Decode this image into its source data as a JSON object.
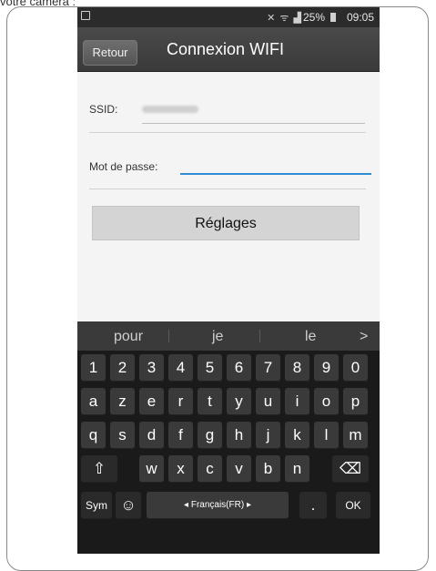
{
  "caption": "votre caméra :",
  "status": {
    "battery": "25%",
    "time": "09:05"
  },
  "nav": {
    "back_label": "Retour",
    "title": "Connexion WIFI"
  },
  "form": {
    "ssid_label": "SSID:",
    "password_label": "Mot de passe:",
    "password_value": "",
    "submit_label": "Réglages"
  },
  "keyboard": {
    "suggestions": [
      "pour",
      "je",
      "le"
    ],
    "suggestion_more": ">",
    "row1": [
      "1",
      "2",
      "3",
      "4",
      "5",
      "6",
      "7",
      "8",
      "9",
      "0"
    ],
    "row2": [
      "a",
      "z",
      "e",
      "r",
      "t",
      "y",
      "u",
      "i",
      "o",
      "p"
    ],
    "row3": [
      "q",
      "s",
      "d",
      "f",
      "g",
      "h",
      "j",
      "k",
      "l",
      "m"
    ],
    "row4": [
      "w",
      "x",
      "c",
      "v",
      "b",
      "n"
    ],
    "shift_label": "⇧",
    "backspace_label": "⌫",
    "sym_label": "Sym",
    "emoji_label": "☺",
    "space_label": "◂  Français(FR)  ▸",
    "period_label": ".",
    "ok_label": "OK"
  }
}
